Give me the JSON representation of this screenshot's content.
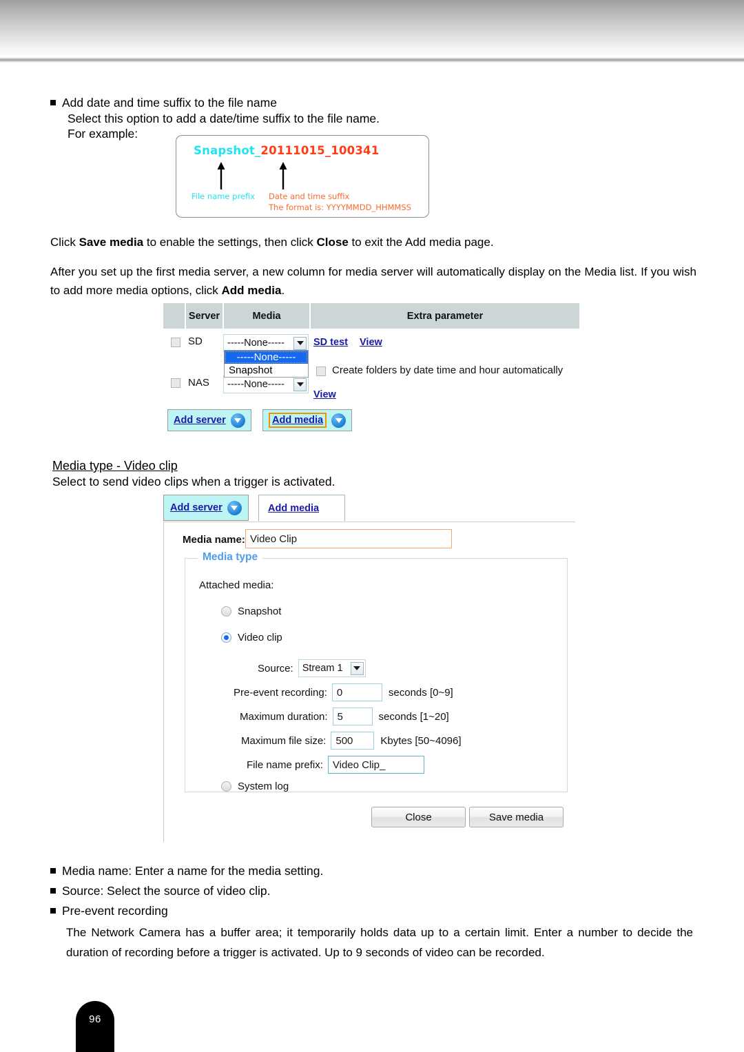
{
  "page": {
    "number": "96"
  },
  "section_a": {
    "bullet1": "Add date and time suffix to the file name",
    "line2": "Select this option to add a date/time suffix to the file name.",
    "line3": "For example:"
  },
  "example": {
    "filename_prefix": "Snapshot_",
    "filename_suffix": "20111015_100341",
    "label_prefix": "File name prefix",
    "label_suffix_line1": "Date and time suffix",
    "label_suffix_line2": "The format is: YYYYMMDD_HHMMSS",
    "color_prefix": "#1fe3f2",
    "color_suffix": "#ff3c14"
  },
  "paragraphs": {
    "p1_pre": "Click ",
    "p1_b1": "Save media",
    "p1_mid": " to enable the settings, then click ",
    "p1_b2": "Close",
    "p1_post": " to exit the Add media page.",
    "p2_pre": "After you set up the first media server, a new column for media server will automatically display on the Media list. If you wish to add more media options, click ",
    "p2_b1": "Add media",
    "p2_post": "."
  },
  "media_table": {
    "headers": [
      "",
      "Server",
      "Media",
      "Extra parameter"
    ],
    "rows": [
      {
        "server": "SD",
        "media_value": "-----None-----",
        "links": [
          "SD test",
          "View"
        ]
      },
      {
        "server": "NAS",
        "media_value": "-----None-----",
        "links": [
          "View"
        ]
      }
    ],
    "dropdown_open": {
      "options": [
        "-----None-----",
        "Snapshot"
      ],
      "selected_index": 0
    },
    "extra_checkbox_label": "Create folders by date time and hour automatically",
    "add_server_label": "Add server",
    "add_media_label": "Add media"
  },
  "section_b": {
    "heading": "Media type - Video clip",
    "subtext": "Select to send video clips when a trigger is activated."
  },
  "panel": {
    "tab_add_server": "Add server",
    "tab_add_media": "Add media",
    "media_name_label": "Media name:",
    "media_name_value": "Video Clip",
    "fieldset_legend": "Media type",
    "attached_media_label": "Attached media:",
    "radio_snapshot": "Snapshot",
    "radio_video_clip": "Video clip",
    "radio_system_log": "System log",
    "selected_radio": "Video clip",
    "source_label": "Source:",
    "source_value": "Stream 1",
    "fields": [
      {
        "label": "Pre-event recording:",
        "value": "0",
        "hint": "seconds [0~9]"
      },
      {
        "label": "Maximum duration:",
        "value": "5",
        "hint": "seconds [1~20]"
      },
      {
        "label": "Maximum file size:",
        "value": "500",
        "hint": "Kbytes [50~4096]"
      }
    ],
    "file_prefix_label": "File name prefix:",
    "file_prefix_value": "Video Clip_",
    "close_button": "Close",
    "save_button": "Save media"
  },
  "section_c": {
    "b1": "Media name: Enter a name for the media setting.",
    "b2": "Source: Select the source of video clip.",
    "b3": "Pre-event recording",
    "para": "The Network Camera has a buffer area; it temporarily holds data up to a certain limit. Enter a number to decide the duration of recording before a trigger is activated. Up to 9 seconds of video can be recorded."
  }
}
